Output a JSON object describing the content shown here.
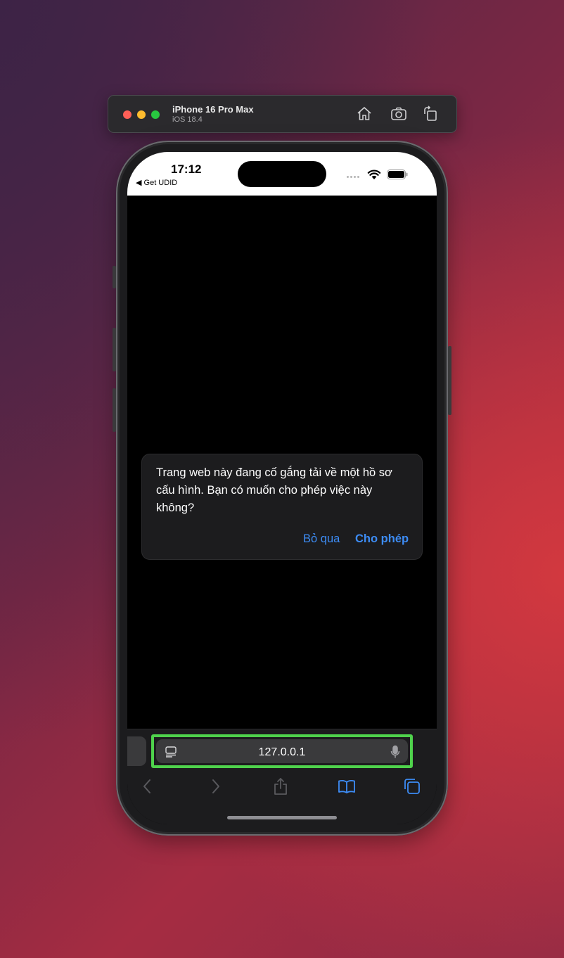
{
  "simulator": {
    "device_name": "iPhone 16 Pro Max",
    "os_version": "iOS 18.4",
    "icons": [
      "home-icon",
      "screenshot-icon",
      "rotate-icon"
    ]
  },
  "status_bar": {
    "time": "17:12",
    "back_app": "◀ Get UDID"
  },
  "dialog": {
    "message": "Trang web này đang cố gắng tải về một hồ sơ cấu hình. Bạn có muốn cho phép việc này không?",
    "skip_label": "Bỏ qua",
    "allow_label": "Cho phép"
  },
  "address_bar": {
    "url": "127.0.0.1",
    "highlight_color": "#4fd24c"
  },
  "toolbar": {
    "icons": [
      "back-icon",
      "forward-icon",
      "share-icon",
      "bookmarks-icon",
      "tabs-icon"
    ],
    "accent_color": "#3d8cf5"
  }
}
